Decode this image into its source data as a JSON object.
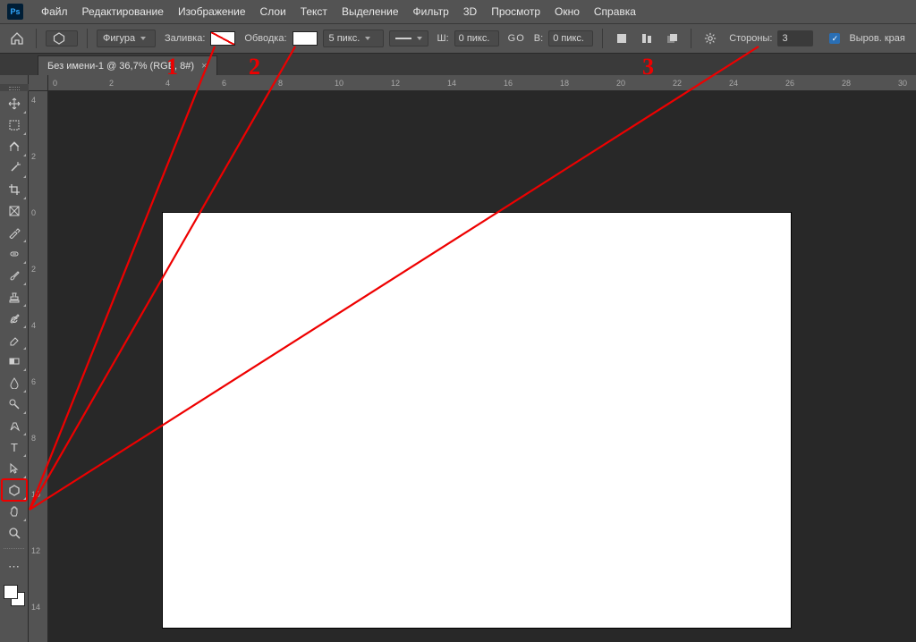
{
  "menubar": [
    "Файл",
    "Редактирование",
    "Изображение",
    "Слои",
    "Текст",
    "Выделение",
    "Фильтр",
    "3D",
    "Просмотр",
    "Окно",
    "Справка"
  ],
  "options": {
    "mode": "Фигура",
    "fill_label": "Заливка:",
    "stroke_label": "Обводка:",
    "stroke_width": "5 пикс.",
    "w_label": "Ш:",
    "w_val": "0 пикс.",
    "link": "GO",
    "h_label": "В:",
    "h_val": "0 пикс.",
    "sides_label": "Стороны:",
    "sides_val": "3",
    "align_label": "Выров. края"
  },
  "doc_tab": "Без имени-1 @ 36,7% (RGB, 8#)",
  "ruler_h": [
    0,
    2,
    4,
    6,
    8,
    10,
    12,
    14,
    16,
    18,
    20,
    22,
    24,
    26,
    28,
    30
  ],
  "ruler_v": [
    4,
    2,
    0,
    2,
    4,
    6,
    8,
    10,
    12,
    14
  ],
  "annotations": {
    "a1": "1",
    "a2": "2",
    "a3": "3"
  }
}
